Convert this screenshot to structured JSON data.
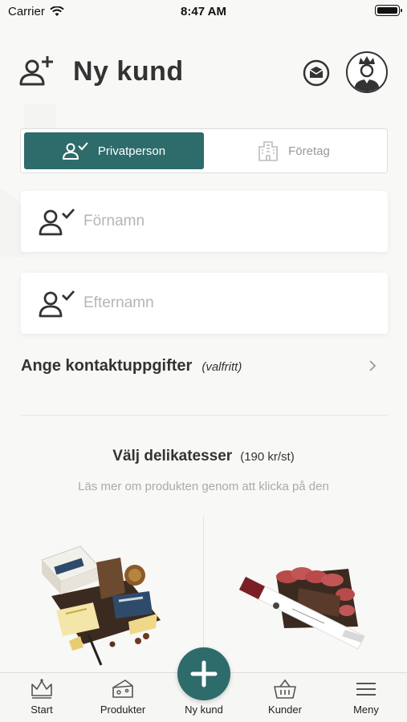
{
  "status_bar": {
    "carrier": "Carrier",
    "time": "8:47 AM"
  },
  "header": {
    "title": "Ny kund"
  },
  "customer_type": {
    "options": [
      {
        "label": "Privatperson",
        "selected": true
      },
      {
        "label": "Företag",
        "selected": false
      }
    ]
  },
  "form": {
    "first_name": {
      "placeholder": "Förnamn",
      "value": ""
    },
    "last_name": {
      "placeholder": "Efternamn",
      "value": ""
    }
  },
  "contact": {
    "label": "Ange kontaktuppgifter",
    "optional": "(valfritt)"
  },
  "products_section": {
    "title": "Välj delikatesser",
    "price": "(190 kr/st)",
    "subtitle": "Läs mer om produkten genom att klicka på den"
  },
  "tab_bar": {
    "items": [
      {
        "label": "Start",
        "icon": "crown-icon"
      },
      {
        "label": "Produkter",
        "icon": "cheese-icon"
      },
      {
        "label": "Ny kund",
        "icon": "plus-icon"
      },
      {
        "label": "Kunder",
        "icon": "basket-icon"
      },
      {
        "label": "Meny",
        "icon": "menu-icon"
      }
    ]
  },
  "colors": {
    "accent": "#2e6b6b",
    "background": "#f8f8f6",
    "text": "#333333",
    "muted": "#b5b5b5"
  }
}
